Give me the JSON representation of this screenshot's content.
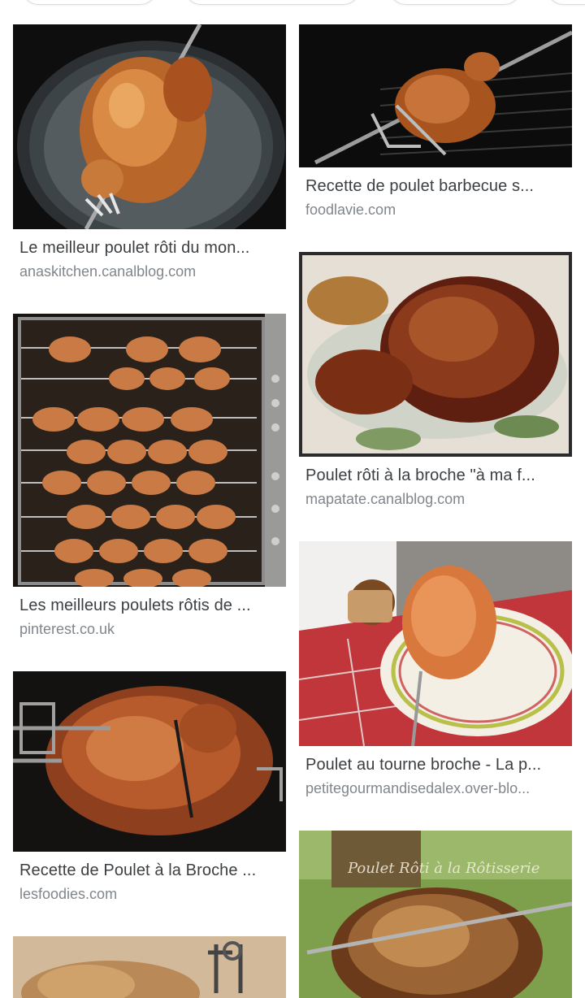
{
  "results": [
    {
      "title": "Le meilleur poulet rôti du mon...",
      "source": "anaskitchen.canalblog.com",
      "image": "roast-chicken-on-spit-plate"
    },
    {
      "title": "Recette de poulet barbecue s...",
      "source": "foodlavie.com",
      "image": "chicken-on-grill-spit"
    },
    {
      "title": "Poulet rôti à la broche \"à ma f...",
      "source": "mapatate.canalblog.com",
      "image": "glazed-roast-chicken"
    },
    {
      "title": "Les meilleurs poulets rôtis de ...",
      "source": "pinterest.co.uk",
      "image": "rotisserie-oven-many-chickens"
    },
    {
      "title": "Poulet au tourne broche - La p...",
      "source": "petitegourmandisedalex.over-blo...",
      "image": "chicken-on-plate-with-spit"
    },
    {
      "title": "Recette de Poulet à la Broche ...",
      "source": "lesfoodies.com",
      "image": "chicken-on-rotisserie-forks"
    },
    {
      "title": "",
      "source": "",
      "image": "rotisserie-spit-partial"
    },
    {
      "title": "",
      "source": "",
      "image": "poulet-roti-rotisserie-outdoor",
      "watermark": "Poulet Rôti à la Rôtisserie"
    }
  ]
}
